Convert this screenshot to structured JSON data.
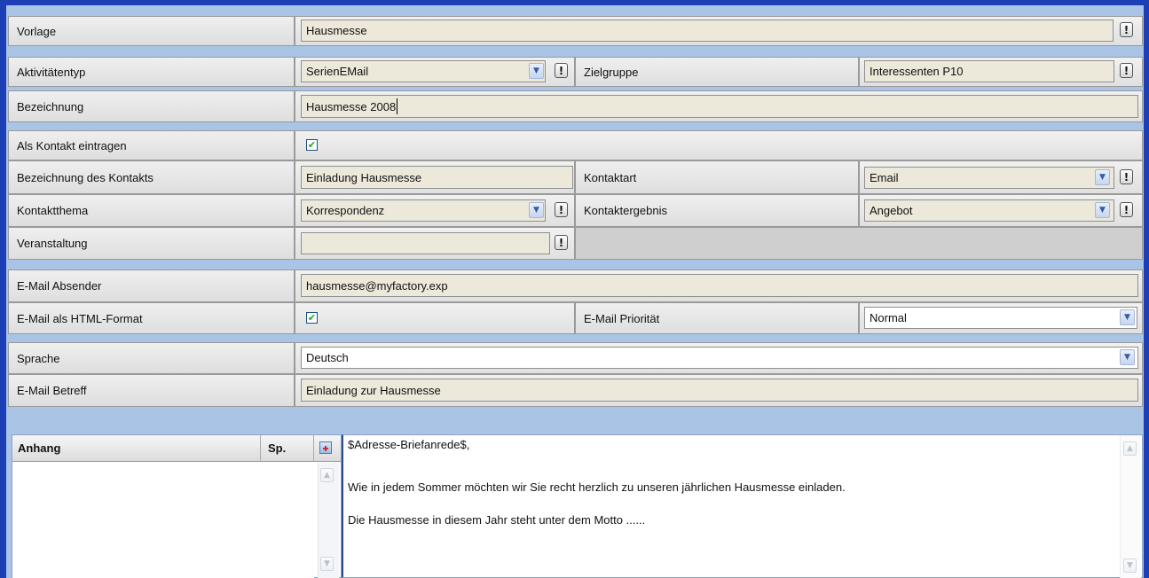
{
  "form": {
    "vorlage": {
      "label": "Vorlage",
      "value": "Hausmesse"
    },
    "aktivitaetentyp": {
      "label": "Aktivitätentyp",
      "value": "SerienEMail"
    },
    "zielgruppe": {
      "label": "Zielgruppe",
      "value": "Interessenten P10"
    },
    "bezeichnung": {
      "label": "Bezeichnung",
      "value": "Hausmesse 2008"
    },
    "als_kontakt": {
      "label": "Als Kontakt eintragen",
      "checked": true
    },
    "bezeichnung_kontakt": {
      "label": "Bezeichnung des Kontakts",
      "value": "Einladung Hausmesse"
    },
    "kontaktart": {
      "label": "Kontaktart",
      "value": "Email"
    },
    "kontaktthema": {
      "label": "Kontaktthema",
      "value": "Korrespondenz"
    },
    "kontaktergebnis": {
      "label": "Kontaktergebnis",
      "value": "Angebot"
    },
    "veranstaltung": {
      "label": "Veranstaltung",
      "value": ""
    },
    "absender": {
      "label": "E-Mail Absender",
      "value": "hausmesse@myfactory.exp"
    },
    "html_format": {
      "label": "E-Mail als HTML-Format",
      "checked": true
    },
    "prioritaet": {
      "label": "E-Mail Priorität",
      "value": "Normal"
    },
    "sprache": {
      "label": "Sprache",
      "value": "Deutsch"
    },
    "betreff": {
      "label": "E-Mail Betreff",
      "value": "Einladung zur Hausmesse"
    }
  },
  "attachments": {
    "col_anhang": "Anhang",
    "col_sp": "Sp.",
    "rows": []
  },
  "editor": {
    "lines": [
      "$Adresse-Briefanrede$,",
      "Wie in jedem Sommer möchten wir Sie recht herzlich zu unseren jährlichen Hausmesse einladen.",
      "Die Hausmesse in diesem Jahr steht unter dem Motto ......"
    ]
  },
  "icons": {
    "alert": "!",
    "dropdown": "▼",
    "check": "✔",
    "scroll_up": "▲",
    "scroll_down": "▼"
  }
}
